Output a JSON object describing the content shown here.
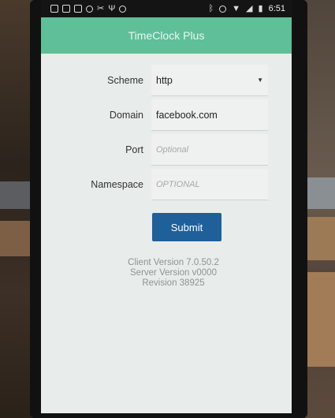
{
  "status_bar": {
    "time": "6:51",
    "left_icons": [
      "facebook-icon",
      "facebook-icon",
      "facebook-icon",
      "circle-notification-icon",
      "tools-icon",
      "usb-icon",
      "android-icon"
    ],
    "right_icons": [
      "bluetooth-icon",
      "minus-circle-icon",
      "wifi-icon",
      "signal-icon",
      "battery-icon"
    ]
  },
  "app": {
    "title": "TimeClock Plus",
    "accent_color": "#5fbf98",
    "button_color": "#1f5f9a"
  },
  "form": {
    "scheme": {
      "label": "Scheme",
      "value": "http"
    },
    "domain": {
      "label": "Domain",
      "value": "facebook.com"
    },
    "port": {
      "label": "Port",
      "placeholder": "Optional"
    },
    "namespace": {
      "label": "Namespace",
      "placeholder": "OPTIONAL"
    },
    "submit_label": "Submit"
  },
  "info": {
    "client_version": "Client Version 7.0.50.2",
    "server_version": "Server Version v0000",
    "revision": "Revision 38925"
  }
}
